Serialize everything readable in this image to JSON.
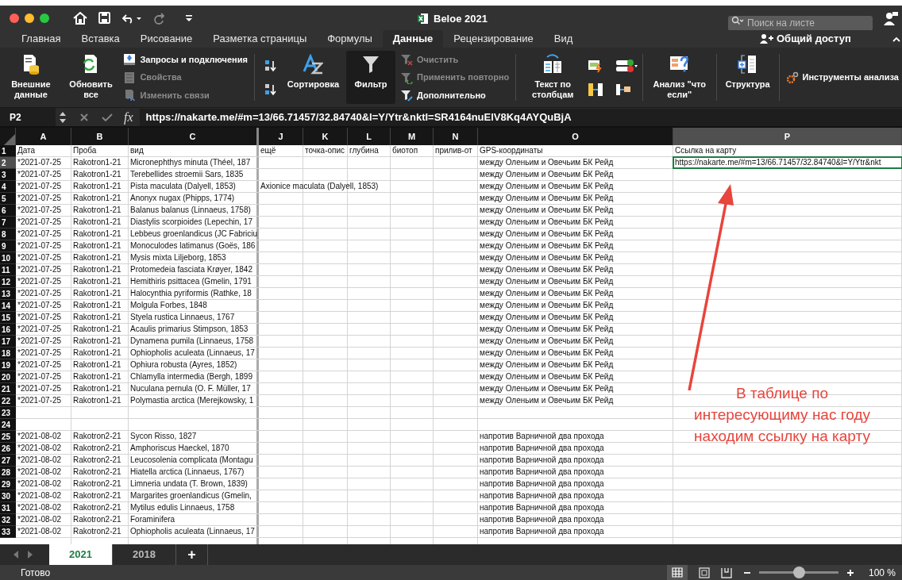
{
  "window": {
    "title": "Beloe 2021",
    "search_placeholder": "Поиск на листе"
  },
  "menu_tabs": [
    {
      "label": "Главная",
      "selected": false
    },
    {
      "label": "Вставка",
      "selected": false
    },
    {
      "label": "Рисование",
      "selected": false
    },
    {
      "label": "Разметка страницы",
      "selected": false
    },
    {
      "label": "Формулы",
      "selected": false
    },
    {
      "label": "Данные",
      "selected": true
    },
    {
      "label": "Рецензирование",
      "selected": false
    },
    {
      "label": "Вид",
      "selected": false
    }
  ],
  "share_button": "Общий доступ",
  "ribbon": [
    [
      {
        "kind": "large",
        "label": "Внешние данные",
        "selected": false
      },
      {
        "kind": "large",
        "label": "Обновить все",
        "selected": false
      },
      {
        "kind": "stack",
        "items": [
          {
            "label": "Запросы и подключения",
            "disabled": false
          },
          {
            "label": "Свойства",
            "disabled": true
          },
          {
            "label": "Изменить связи",
            "disabled": true
          }
        ]
      }
    ],
    [
      {
        "kind": "sortpair"
      },
      {
        "kind": "large",
        "label": "Сортировка",
        "selected": false
      },
      {
        "kind": "large",
        "label": "Фильтр",
        "selected": true
      },
      {
        "kind": "stack",
        "items": [
          {
            "label": "Очистить",
            "disabled": true
          },
          {
            "label": "Применить повторно",
            "disabled": true
          },
          {
            "label": "Дополнительно",
            "disabled": false
          }
        ]
      }
    ],
    [
      {
        "kind": "large",
        "label": "Текст по столбцам",
        "selected": false
      },
      {
        "kind": "toolgrid"
      }
    ],
    [
      {
        "kind": "large",
        "label": "Анализ \"что если\"",
        "selected": false
      }
    ],
    [
      {
        "kind": "large",
        "label": "Структура",
        "selected": false
      }
    ],
    [
      {
        "kind": "stack",
        "items": [
          {
            "label": "Инструменты анализа",
            "disabled": false
          }
        ]
      }
    ]
  ],
  "formula_bar": {
    "cell_ref": "P2",
    "fx": "fx",
    "formula": "https://nakarte.me/#m=13/66.71457/32.84740&l=Y/Ytr&nktl=SR4164nuElV8Kq4AYQuBjA"
  },
  "columns": [
    {
      "letter": "A",
      "selected": false
    },
    {
      "letter": "B",
      "selected": false
    },
    {
      "letter": "C",
      "selected": false
    },
    {
      "letter": "J",
      "selected": false
    },
    {
      "letter": "K",
      "selected": false
    },
    {
      "letter": "L",
      "selected": false
    },
    {
      "letter": "M",
      "selected": false
    },
    {
      "letter": "N",
      "selected": false
    },
    {
      "letter": "O",
      "selected": false
    },
    {
      "letter": "P",
      "selected": true
    }
  ],
  "rows": [
    {
      "number": "1",
      "selected": false,
      "cells": {
        "a": "Дата",
        "b": "Проба",
        "c": "вид",
        "j": "ещё",
        "k": "точка-опис",
        "l": "глубина",
        "m": "биотоп",
        "n": "прилив-от",
        "o": "GPS-координаты",
        "p": "Ссылка на карту"
      }
    },
    {
      "number": "2",
      "selected": true,
      "cells": {
        "a": "*2021-07-25",
        "b": "Rakotron1-21",
        "c": "Micronephthys minuta (Théel, 187",
        "o": "между Оленьим и Овечьим БК Рейд",
        "p": "https://nakarte.me/#m=13/66.71457/32.84740&l=Y/Ytr&nkt"
      }
    },
    {
      "number": "3",
      "selected": false,
      "cells": {
        "a": "*2021-07-25",
        "b": "Rakotron1-21",
        "c": "Terebellides stroemii Sars, 1835",
        "o": "между Оленьим и Овечьим БК Рейд"
      }
    },
    {
      "number": "4",
      "selected": false,
      "cells": {
        "a": "*2021-07-25",
        "b": "Rakotron1-21",
        "c": "Pista maculata (Dalyell, 1853)",
        "j": "Axionice maculata (Dalyell, 1853)",
        "o": "между Оленьим и Овечьим БК Рейд"
      }
    },
    {
      "number": "5",
      "selected": false,
      "cells": {
        "a": "*2021-07-25",
        "b": "Rakotron1-21",
        "c": "Anonyx nugax (Phipps, 1774)",
        "o": "между Оленьим и Овечьим БК Рейд"
      }
    },
    {
      "number": "6",
      "selected": false,
      "cells": {
        "a": "*2021-07-25",
        "b": "Rakotron1-21",
        "c": "Balanus balanus (Linnaeus, 1758)",
        "o": "между Оленьим и Овечьим БК Рейд"
      }
    },
    {
      "number": "7",
      "selected": false,
      "cells": {
        "a": "*2021-07-25",
        "b": "Rakotron1-21",
        "c": "Diastylis scorpioides (Lepechin, 17",
        "o": "между Оленьим и Овечьим БК Рейд"
      }
    },
    {
      "number": "8",
      "selected": false,
      "cells": {
        "a": "*2021-07-25",
        "b": "Rakotron1-21",
        "c": "Lebbeus groenlandicus (JC Fabriciu",
        "o": "между Оленьим и Овечьим БК Рейд"
      }
    },
    {
      "number": "9",
      "selected": false,
      "cells": {
        "a": "*2021-07-25",
        "b": "Rakotron1-21",
        "c": "Monoculodes latimanus (Goës, 186",
        "o": "между Оленьим и Овечьим БК Рейд"
      }
    },
    {
      "number": "10",
      "selected": false,
      "cells": {
        "a": "*2021-07-25",
        "b": "Rakotron1-21",
        "c": "Mysis mixta Liljeborg, 1853",
        "o": "между Оленьим и Овечьим БК Рейд"
      }
    },
    {
      "number": "11",
      "selected": false,
      "cells": {
        "a": "*2021-07-25",
        "b": "Rakotron1-21",
        "c": "Protomedeia fasciata Krøyer, 1842",
        "o": "между Оленьим и Овечьим БК Рейд"
      }
    },
    {
      "number": "12",
      "selected": false,
      "cells": {
        "a": "*2021-07-25",
        "b": "Rakotron1-21",
        "c": "Hemithiris psittacea (Gmelin, 1791",
        "o": "между Оленьим и Овечьим БК Рейд"
      }
    },
    {
      "number": "13",
      "selected": false,
      "cells": {
        "a": "*2021-07-25",
        "b": "Rakotron1-21",
        "c": "Halocynthia pyriformis (Rathke, 18",
        "o": "между Оленьим и Овечьим БК Рейд"
      }
    },
    {
      "number": "14",
      "selected": false,
      "cells": {
        "a": "*2021-07-25",
        "b": "Rakotron1-21",
        "c": "Molgula Forbes, 1848",
        "o": "между Оленьим и Овечьим БК Рейд"
      }
    },
    {
      "number": "15",
      "selected": false,
      "cells": {
        "a": "*2021-07-25",
        "b": "Rakotron1-21",
        "c": "Styela rustica Linnaeus, 1767",
        "o": "между Оленьим и Овечьим БК Рейд"
      }
    },
    {
      "number": "16",
      "selected": false,
      "cells": {
        "a": "*2021-07-25",
        "b": "Rakotron1-21",
        "c": "Acaulis primarius Stimpson, 1853",
        "o": "между Оленьим и Овечьим БК Рейд"
      }
    },
    {
      "number": "17",
      "selected": false,
      "cells": {
        "a": "*2021-07-25",
        "b": "Rakotron1-21",
        "c": "Dynamena pumila (Linnaeus, 1758",
        "o": "между Оленьим и Овечьим БК Рейд"
      }
    },
    {
      "number": "18",
      "selected": false,
      "cells": {
        "a": "*2021-07-25",
        "b": "Rakotron1-21",
        "c": "Ophiopholis aculeata (Linnaeus, 17",
        "o": "между Оленьим и Овечьим БК Рейд"
      }
    },
    {
      "number": "19",
      "selected": false,
      "cells": {
        "a": "*2021-07-25",
        "b": "Rakotron1-21",
        "c": "Ophiura robusta (Ayres, 1852)",
        "o": "между Оленьим и Овечьим БК Рейд"
      }
    },
    {
      "number": "20",
      "selected": false,
      "cells": {
        "a": "*2021-07-25",
        "b": "Rakotron1-21",
        "c": "Chlamylla intermedia (Bergh, 1899",
        "o": "между Оленьим и Овечьим БК Рейд"
      }
    },
    {
      "number": "21",
      "selected": false,
      "cells": {
        "a": "*2021-07-25",
        "b": "Rakotron1-21",
        "c": "Nuculana pernula (O. F. Müller, 17",
        "o": "между Оленьим и Овечьим БК Рейд"
      }
    },
    {
      "number": "22",
      "selected": false,
      "cells": {
        "a": "*2021-07-25",
        "b": "Rakotron1-21",
        "c": "Polymastia arctica (Merejkowsky, 1",
        "o": "между Оленьим и Овечьим БК Рейд"
      }
    },
    {
      "number": "23",
      "selected": false,
      "cells": {}
    },
    {
      "number": "24",
      "selected": false,
      "cells": {}
    },
    {
      "number": "25",
      "selected": false,
      "cells": {
        "a": "*2021-08-02",
        "b": "Rakotron2-21",
        "c": "Sycon Risso, 1827",
        "o": "напротив Варничной два прохода"
      }
    },
    {
      "number": "26",
      "selected": false,
      "cells": {
        "a": "*2021-08-02",
        "b": "Rakotron2-21",
        "c": "Amphoriscus Haeckel, 1870",
        "o": "напротив Варничной два прохода"
      }
    },
    {
      "number": "27",
      "selected": false,
      "cells": {
        "a": "*2021-08-02",
        "b": "Rakotron2-21",
        "c": "Leucosolenia complicata (Montagu",
        "o": "напротив Варничной два прохода"
      }
    },
    {
      "number": "28",
      "selected": false,
      "cells": {
        "a": "*2021-08-02",
        "b": "Rakotron2-21",
        "c": "Hiatella arctica (Linnaeus, 1767)",
        "o": "напротив Варничной два прохода"
      }
    },
    {
      "number": "29",
      "selected": false,
      "cells": {
        "a": "*2021-08-02",
        "b": "Rakotron2-21",
        "c": "Limneria undata (T. Brown, 1839)",
        "o": "напротив Варничной два прохода"
      }
    },
    {
      "number": "30",
      "selected": false,
      "cells": {
        "a": "*2021-08-02",
        "b": "Rakotron2-21",
        "c": "Margarites groenlandicus (Gmelin,",
        "o": "напротив Варничной два прохода"
      }
    },
    {
      "number": "31",
      "selected": false,
      "cells": {
        "a": "*2021-08-02",
        "b": "Rakotron2-21",
        "c": "Mytilus edulis Linnaeus, 1758",
        "o": "напротив Варничной два прохода"
      }
    },
    {
      "number": "32",
      "selected": false,
      "cells": {
        "a": "*2021-08-02",
        "b": "Rakotron2-21",
        "c": "Foraminifera",
        "o": "напротив Варничной два прохода"
      }
    },
    {
      "number": "33",
      "selected": false,
      "cells": {
        "a": "*2021-08-02",
        "b": "Rakotron2-21",
        "c": "Ophiopholis aculeata (Linnaeus, 17",
        "o": "напротив Варничной два прохода"
      }
    }
  ],
  "annotation": "В таблице по\nинтересующиму нас году\nнаходим ссылку на карту",
  "sheet_tabs": [
    {
      "label": "2021",
      "selected": true
    },
    {
      "label": "2018",
      "selected": false
    }
  ],
  "add_sheet": "+",
  "status_bar": {
    "status": "Готово",
    "zoom": {
      "level": 0.5
    },
    "zoom_reading": "100 %"
  }
}
